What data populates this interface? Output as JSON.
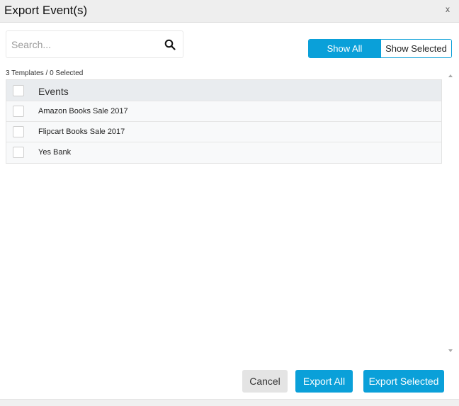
{
  "dialog": {
    "title": "Export Event(s)",
    "close_label": "x"
  },
  "search": {
    "placeholder": "Search...",
    "value": ""
  },
  "toggle": {
    "show_all": "Show All",
    "show_selected": "Show Selected",
    "active": "show_all"
  },
  "summary": {
    "text": "3 Templates / 0 Selected"
  },
  "table": {
    "header": "Events",
    "rows": [
      {
        "name": "Amazon Books Sale 2017",
        "selected": false
      },
      {
        "name": "Flipcart Books Sale 2017",
        "selected": false
      },
      {
        "name": "Yes Bank",
        "selected": false
      }
    ]
  },
  "footer": {
    "cancel": "Cancel",
    "export_all": "Export All",
    "export_selected": "Export Selected"
  },
  "colors": {
    "accent": "#0aa0d9",
    "header_bg": "#e9ecef",
    "titlebar_bg": "#eeeeee"
  }
}
